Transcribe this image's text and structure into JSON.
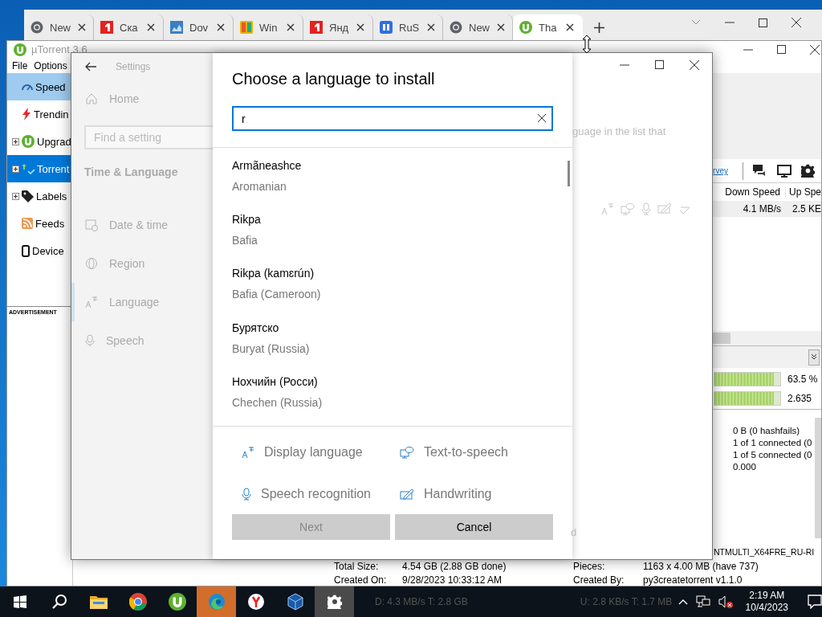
{
  "browser": {
    "tabs": [
      {
        "title": "New",
        "kind": "chrome",
        "selected": false
      },
      {
        "title": "Ска",
        "kind": "red",
        "selected": false
      },
      {
        "title": "Dov",
        "kind": "chart",
        "selected": false
      },
      {
        "title": "Win",
        "kind": "grid",
        "selected": false
      },
      {
        "title": "Янд",
        "kind": "red",
        "selected": false
      },
      {
        "title": "RuS",
        "kind": "book",
        "selected": false
      },
      {
        "title": "New",
        "kind": "chrome",
        "selected": false
      },
      {
        "title": "Tha",
        "kind": "utorrent",
        "selected": true
      }
    ]
  },
  "utorrent": {
    "title": "µTorrent 3.6",
    "menu": [
      "File",
      "Options"
    ],
    "sidebar": [
      {
        "label": "Speed",
        "kind": "speed",
        "expander": false,
        "hover": true,
        "selected": false
      },
      {
        "label": "Trendin",
        "kind": "trending",
        "expander": false,
        "hover": false,
        "selected": false
      },
      {
        "label": "Upgrad",
        "kind": "upgrade",
        "expander": true,
        "hover": false,
        "selected": false
      },
      {
        "label": "Torrent",
        "kind": "torrents",
        "expander": true,
        "hover": false,
        "selected": true
      },
      {
        "label": "Labels",
        "kind": "labels",
        "expander": true,
        "hover": false,
        "selected": false
      },
      {
        "label": "Feeds",
        "kind": "feeds",
        "expander": false,
        "hover": false,
        "selected": false
      },
      {
        "label": "Device",
        "kind": "devices",
        "expander": false,
        "hover": false,
        "selected": false
      }
    ],
    "advertisement": "ADVERTISEMENT",
    "link": "rvey",
    "columns": [
      "Down Speed",
      "Up Spe"
    ],
    "row": [
      "4.1 MB/s",
      "2.5 KE"
    ],
    "pieces": [
      {
        "level": 0.9,
        "reading": "63.5 %"
      },
      {
        "level": 0.9,
        "reading": "2.635"
      }
    ],
    "info": [
      "0 B (0 hashfails)",
      "1 of 1 connected (0",
      "1 of 5 connected (0",
      "0.000"
    ],
    "file_name": "NTMULTI_X64FRE_RU-RI",
    "general": [
      [
        "Total Size:",
        "4.54 GB (2.88 GB done)",
        "Pieces:",
        "1163 x 4.00 MB (have 737)"
      ],
      [
        "Created On:",
        "9/28/2023 10:33:12 AM",
        "Created By:",
        "py3createtorrent v1.1.0"
      ]
    ],
    "status": [
      "D: 4.3 MB/s T: 2.8 GB",
      "U: 2.8 KB/s T: 1.7 MB"
    ]
  },
  "settings": {
    "title": "Settings",
    "home": "Home",
    "search": {
      "placeholder": "Find a setting"
    },
    "section": "Time & Language",
    "items": [
      {
        "label": "Date & time",
        "kind": "date",
        "selected": false
      },
      {
        "label": "Region",
        "kind": "region",
        "selected": false
      },
      {
        "label": "Language",
        "kind": "language",
        "selected": true
      },
      {
        "label": "Speech",
        "kind": "speech",
        "selected": false
      }
    ],
    "hint": "guage in the list that",
    "hint_end": "d"
  },
  "dialog": {
    "title": "Choose a language to install",
    "search": {
      "value": "r"
    },
    "languages": [
      {
        "native": "Armãneashce",
        "english": "Aromanian"
      },
      {
        "native": "Rikpa",
        "english": "Bafia"
      },
      {
        "native": "Rikpa (kamɛrún)",
        "english": "Bafia (Cameroon)"
      },
      {
        "native": "Бурятско",
        "english": "Buryat (Russia)"
      },
      {
        "native": "Нохчийн (Росси)",
        "english": "Chechen (Russia)"
      }
    ],
    "features": [
      {
        "label": "Display language",
        "kind": "display"
      },
      {
        "label": "Text-to-speech",
        "kind": "tts"
      },
      {
        "label": "Speech recognition",
        "kind": "speech"
      },
      {
        "label": "Handwriting",
        "kind": "handwriting"
      }
    ],
    "buttons": [
      {
        "label": "Next",
        "disabled": true
      },
      {
        "label": "Cancel",
        "disabled": false
      }
    ]
  },
  "taskbar": {
    "apps": [
      {
        "kind": "start",
        "active": false,
        "flashing": false
      },
      {
        "kind": "search",
        "active": false,
        "flashing": false
      },
      {
        "kind": "explorer",
        "active": false,
        "flashing": false
      },
      {
        "kind": "chrome",
        "active": false,
        "flashing": false
      },
      {
        "kind": "utorrent",
        "active": false,
        "flashing": false
      },
      {
        "kind": "edge",
        "active": false,
        "flashing": true
      },
      {
        "kind": "yandex",
        "active": false,
        "flashing": false
      },
      {
        "kind": "vbox",
        "active": false,
        "flashing": false
      },
      {
        "kind": "settings",
        "active": true,
        "flashing": false
      }
    ],
    "time": "2:19 AM",
    "date": "10/4/2023"
  }
}
